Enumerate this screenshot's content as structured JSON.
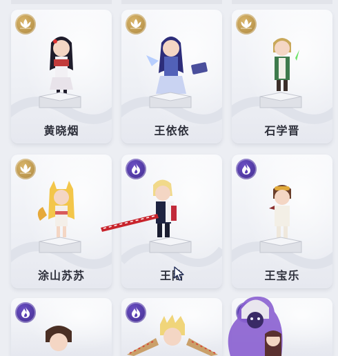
{
  "cards": [
    {
      "name": "黄晓烟",
      "badge": "lotus-icon"
    },
    {
      "name": "王依依",
      "badge": "lotus-icon"
    },
    {
      "name": "石学晋",
      "badge": "lotus-icon"
    },
    {
      "name": "涂山苏苏",
      "badge": "lotus-icon"
    },
    {
      "name": "王陆",
      "badge": "flame-icon"
    },
    {
      "name": "王宝乐",
      "badge": "flame-icon"
    },
    {
      "name": "",
      "badge": "flame-icon"
    },
    {
      "name": "",
      "badge": "flame-icon"
    },
    {
      "name": "",
      "badge": "flame-icon"
    }
  ],
  "colors": {
    "gold_badge": "#b8924a",
    "purple_badge": "#4a33a0",
    "card_bg": "#f2f3f7",
    "page_bg": "#eceef3"
  }
}
